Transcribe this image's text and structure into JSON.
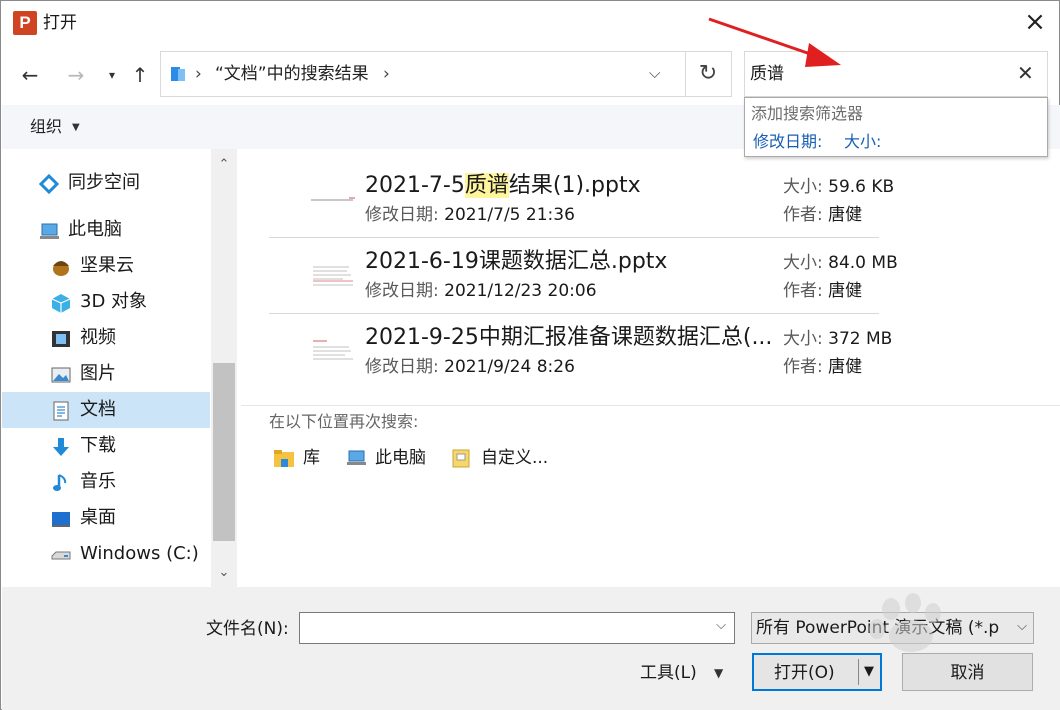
{
  "window": {
    "title": "打开",
    "app_icon_letter": "P"
  },
  "nav": {
    "breadcrumb": [
      "“文档”中的搜索结果"
    ]
  },
  "search": {
    "value": "质谱"
  },
  "suggest": {
    "header": "添加搜索筛选器",
    "filters": [
      "修改日期:",
      "大小:"
    ]
  },
  "toolbar": {
    "organize": "组织"
  },
  "sidebar": {
    "items": [
      {
        "label": "同步空间",
        "icon": "sync-space-icon"
      },
      {
        "label": "此电脑",
        "icon": "this-pc-icon"
      },
      {
        "label": "坚果云",
        "icon": "nutstore-icon"
      },
      {
        "label": "3D 对象",
        "icon": "3d-objects-icon"
      },
      {
        "label": "视频",
        "icon": "video-icon"
      },
      {
        "label": "图片",
        "icon": "pictures-icon"
      },
      {
        "label": "文档",
        "icon": "documents-icon",
        "selected": true
      },
      {
        "label": "下载",
        "icon": "download-icon"
      },
      {
        "label": "音乐",
        "icon": "music-icon"
      },
      {
        "label": "桌面",
        "icon": "desktop-icon"
      },
      {
        "label": "Windows (C:)",
        "icon": "drive-icon"
      }
    ]
  },
  "results": {
    "files": [
      {
        "name_pre": "2021-7-5",
        "name_hl": "质谱",
        "name_post": "结果(1).pptx",
        "modified_label": "修改日期:",
        "modified": "2021/7/5 21:36",
        "size_label": "大小:",
        "size": "59.6 KB",
        "author_label": "作者:",
        "author": "唐健"
      },
      {
        "name_pre": "2021-6-19课题数据汇总.pptx",
        "name_hl": "",
        "name_post": "",
        "modified_label": "修改日期:",
        "modified": "2021/12/23 20:06",
        "size_label": "大小:",
        "size": "84.0 MB",
        "author_label": "作者:",
        "author": "唐健"
      },
      {
        "name_pre": "2021-9-25中期汇报准备课题数据汇总(...",
        "name_hl": "",
        "name_post": "",
        "modified_label": "修改日期:",
        "modified": "2021/9/24 8:26",
        "size_label": "大小:",
        "size": "372 MB",
        "author_label": "作者:",
        "author": "唐健"
      }
    ],
    "search_again_label": "在以下位置再次搜索:",
    "locations": [
      {
        "label": "库",
        "icon": "library-icon"
      },
      {
        "label": "此电脑",
        "icon": "this-pc-icon"
      },
      {
        "label": "自定义...",
        "icon": "custom-folder-icon"
      }
    ]
  },
  "bottom": {
    "filename_label": "文件名(N):",
    "filename_value": "",
    "filter_value": "所有 PowerPoint 演示文稿 (*.p",
    "tools_label": "工具(L)",
    "open_label": "打开(O)",
    "cancel_label": "取消"
  },
  "colors": {
    "accent": "#0078d7",
    "selection": "#cce4f7",
    "highlight": "#fff59d",
    "link": "#1a5fb4",
    "arrow": "#e02020"
  }
}
